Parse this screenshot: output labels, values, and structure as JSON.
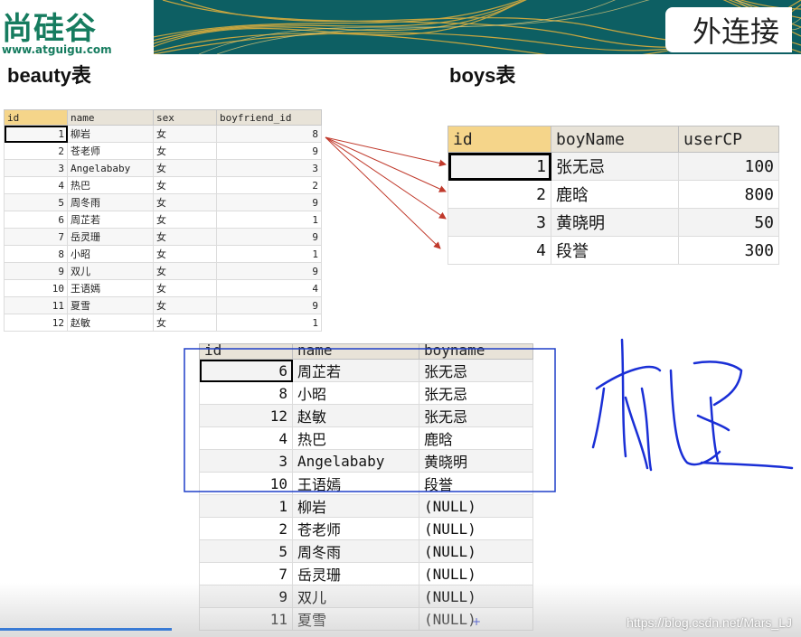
{
  "header": {
    "logo_text": "尚硅谷",
    "logo_url": "www.atguigu.com",
    "slide_title": "外连接"
  },
  "labels": {
    "beauty": "beauty表",
    "boys": "boys表"
  },
  "beauty_table": {
    "columns": [
      "id",
      "name",
      "sex",
      "boyfriend_id"
    ],
    "rows": [
      [
        "1",
        "柳岩",
        "女",
        "8"
      ],
      [
        "2",
        "苍老师",
        "女",
        "9"
      ],
      [
        "3",
        "Angelababy",
        "女",
        "3"
      ],
      [
        "4",
        "热巴",
        "女",
        "2"
      ],
      [
        "5",
        "周冬雨",
        "女",
        "9"
      ],
      [
        "6",
        "周芷若",
        "女",
        "1"
      ],
      [
        "7",
        "岳灵珊",
        "女",
        "9"
      ],
      [
        "8",
        "小昭",
        "女",
        "1"
      ],
      [
        "9",
        "双儿",
        "女",
        "9"
      ],
      [
        "10",
        "王语嫣",
        "女",
        "4"
      ],
      [
        "11",
        "夏雪",
        "女",
        "9"
      ],
      [
        "12",
        "赵敏",
        "女",
        "1"
      ]
    ]
  },
  "boys_table": {
    "columns": [
      "id",
      "boyName",
      "userCP"
    ],
    "rows": [
      [
        "1",
        "张无忌",
        "100"
      ],
      [
        "2",
        "鹿晗",
        "800"
      ],
      [
        "3",
        "黄晓明",
        "50"
      ],
      [
        "4",
        "段誉",
        "300"
      ]
    ]
  },
  "result_table": {
    "columns": [
      "id",
      "name",
      "boyname"
    ],
    "rows": [
      [
        "6",
        "周芷若",
        "张无忌"
      ],
      [
        "8",
        "小昭",
        "张无忌"
      ],
      [
        "12",
        "赵敏",
        "张无忌"
      ],
      [
        "4",
        "热巴",
        "鹿晗"
      ],
      [
        "3",
        "Angelababy",
        "黄晓明"
      ],
      [
        "10",
        "王语嫣",
        "段誉"
      ],
      [
        "1",
        "柳岩",
        "(NULL)"
      ],
      [
        "2",
        "苍老师",
        "(NULL)"
      ],
      [
        "5",
        "周冬雨",
        "(NULL)"
      ],
      [
        "7",
        "岳灵珊",
        "(NULL)"
      ],
      [
        "9",
        "双儿",
        "(NULL)"
      ],
      [
        "11",
        "夏雪",
        "(NULL)"
      ]
    ]
  },
  "watermark": "https://blog.csdn.net/Mars_LJ",
  "colors": {
    "banner": "#0d5f63",
    "logo": "#167c5f",
    "arrow": "#c0392b",
    "highlight_box": "#1f3fc8",
    "ink": "#1a2fd6"
  },
  "video_progress": 0.215
}
